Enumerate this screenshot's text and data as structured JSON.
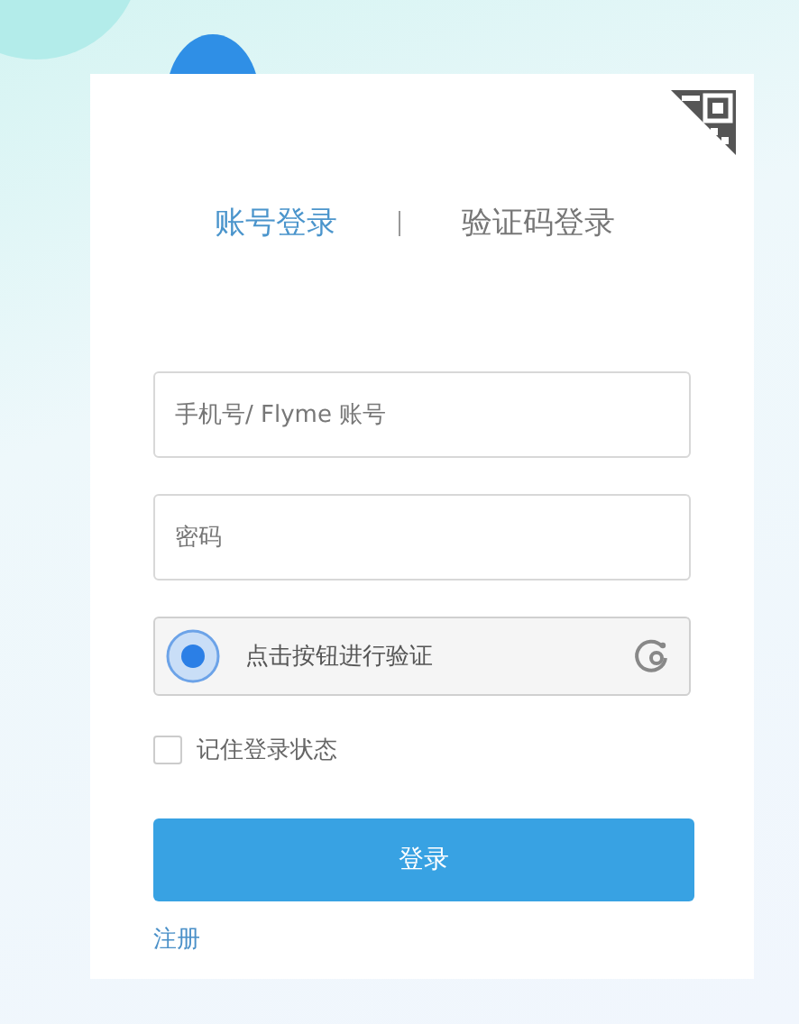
{
  "tabs": [
    {
      "label": "账号登录",
      "selected": true
    },
    {
      "label": "验证码登录",
      "selected": false
    }
  ],
  "fields": [
    {
      "placeholder": "手机号/ Flyme 账号"
    },
    {
      "placeholder": "密码"
    }
  ],
  "captcha": {
    "label": "点击按钮进行验证"
  },
  "remember": {
    "label": "记住登录状态",
    "checked": false
  },
  "login_button": "登录",
  "register_link": "注册"
}
